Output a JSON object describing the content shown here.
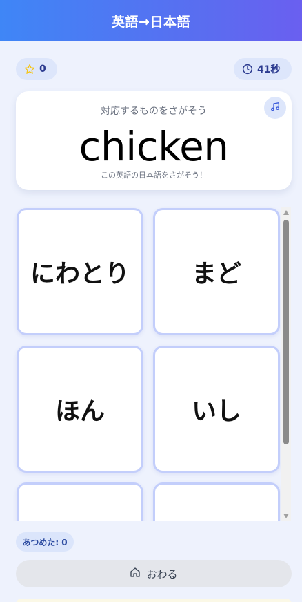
{
  "header": {
    "title": "英語→日本語"
  },
  "status": {
    "score": "0",
    "timer": "41秒"
  },
  "prompt": {
    "instruction": "対応するものをさがそう",
    "word": "chicken",
    "hint": "この英語の日本語をさがそう！"
  },
  "choices": [
    {
      "label": "にわとり"
    },
    {
      "label": "まど"
    },
    {
      "label": "ほん"
    },
    {
      "label": "いし"
    },
    {
      "label": ""
    },
    {
      "label": ""
    }
  ],
  "footer": {
    "collected": "あつめた: 0",
    "finish_label": "おわる"
  },
  "icons": {
    "score": "star-icon",
    "timer": "clock-icon",
    "sound": "music-note-icon",
    "finish": "home-icon"
  },
  "colors": {
    "header_start": "#3f86f6",
    "header_end": "#6a5ff0",
    "card_border": "#c3cefb",
    "star": "#f5c518",
    "accent": "#2b3a8f"
  }
}
